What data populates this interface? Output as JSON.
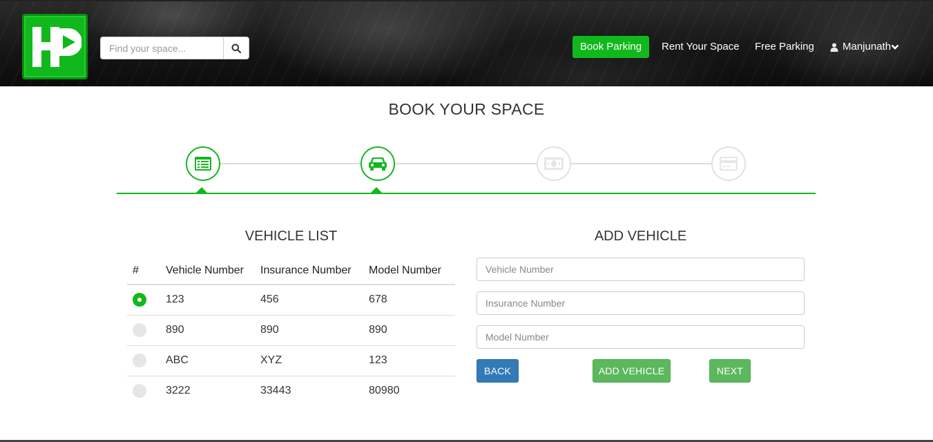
{
  "header": {
    "logo_text": "HP",
    "search": {
      "placeholder": "Find your space..."
    },
    "nav": {
      "book_parking": "Book Parking",
      "rent_your_space": "Rent Your Space",
      "free_parking": "Free Parking",
      "user_name": "Manjunath"
    }
  },
  "page_title": "BOOK YOUR SPACE",
  "stepper": {
    "steps": [
      {
        "icon": "list-icon",
        "state": "active"
      },
      {
        "icon": "car-icon",
        "state": "active"
      },
      {
        "icon": "money-icon",
        "state": "inactive"
      },
      {
        "icon": "credit-card-icon",
        "state": "inactive"
      }
    ]
  },
  "vehicle_list": {
    "title": "VEHICLE LIST",
    "columns": [
      "#",
      "Vehicle Number",
      "Insurance Number",
      "Model Number"
    ],
    "rows": [
      {
        "selected": true,
        "vehicle": "123",
        "insurance": "456",
        "model": "678"
      },
      {
        "selected": false,
        "vehicle": "890",
        "insurance": "890",
        "model": "890"
      },
      {
        "selected": false,
        "vehicle": "ABC",
        "insurance": "XYZ",
        "model": "123"
      },
      {
        "selected": false,
        "vehicle": "3222",
        "insurance": "33443",
        "model": "80980"
      }
    ]
  },
  "add_vehicle": {
    "title": "ADD VEHICLE",
    "vehicle_placeholder": "Vehicle Number",
    "insurance_placeholder": "Insurance Number",
    "model_placeholder": "Model Number",
    "back_label": "BACK",
    "add_label": "ADD VEHICLE",
    "next_label": "NEXT"
  },
  "colors": {
    "brand_green": "#11b81c",
    "primary_blue": "#337ab7",
    "success_green": "#5cb85c"
  }
}
